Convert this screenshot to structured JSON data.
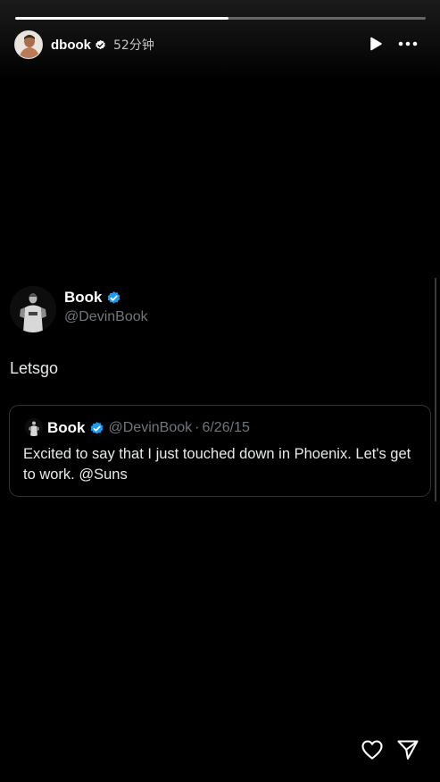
{
  "story": {
    "progress_fraction": 0.52,
    "username": "dbook",
    "time_ago": "52分钟",
    "icons": {
      "verified": "verified-badge-icon",
      "play": "play-icon",
      "more": "more-horizontal-icon",
      "like": "heart-icon",
      "share": "send-icon"
    }
  },
  "tweet": {
    "name": "Book",
    "handle": "@DevinBook",
    "text": "Letsgo",
    "quote": {
      "name": "Book",
      "handle": "@DevinBook",
      "separator": "·",
      "date": "6/26/15",
      "text": "Excited to say that I just touched down in Phoenix. Let's get to work. @Suns"
    }
  },
  "colors": {
    "background": "#000000",
    "verified_blue": "#1d9bf0",
    "secondary_text": "#71767b",
    "card_border": "#2f3336"
  }
}
